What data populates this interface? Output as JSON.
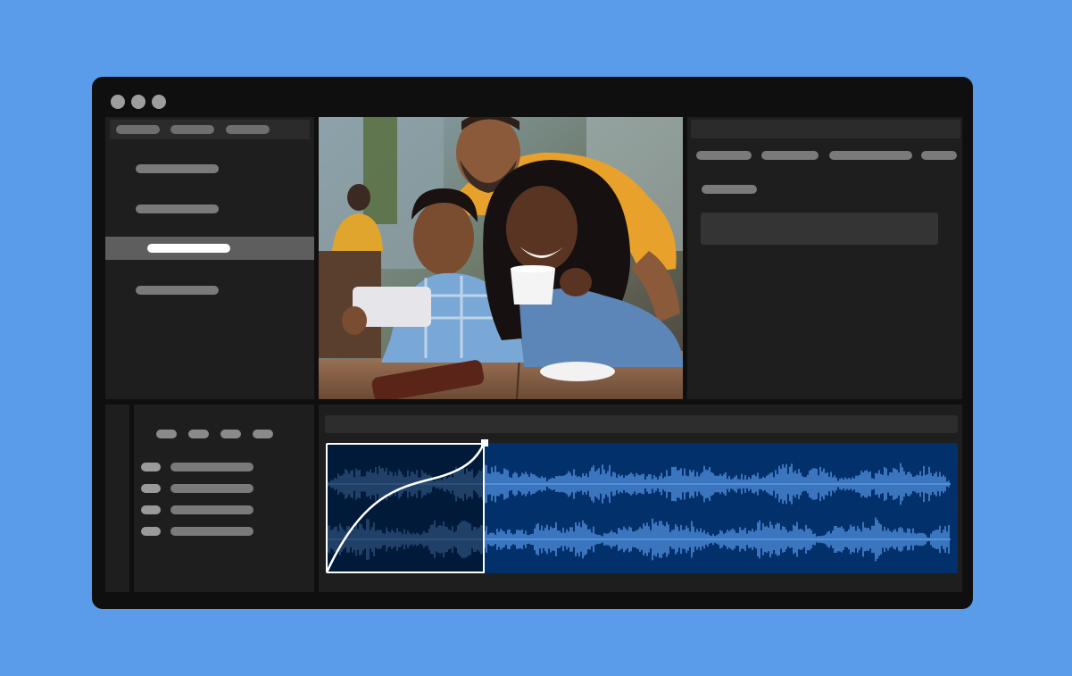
{
  "window": {
    "controls": [
      "close",
      "minimize",
      "maximize"
    ]
  },
  "media_list": {
    "items": 4,
    "selected_index": 2
  },
  "timeline": {
    "audio_clip_tracks": 2,
    "fade_in": {
      "curve": "ease",
      "handle": "square"
    }
  },
  "colors": {
    "background": "#5a9bea",
    "window": "#0f0f0f",
    "panel": "#1e1e1e",
    "audio_clip": "#02306b",
    "waveform": "#5a9bea",
    "selection": "#5e5e5e"
  },
  "icons": [
    "window-close-icon",
    "window-minimize-icon",
    "window-maximize-icon",
    "fade-handle-icon"
  ]
}
